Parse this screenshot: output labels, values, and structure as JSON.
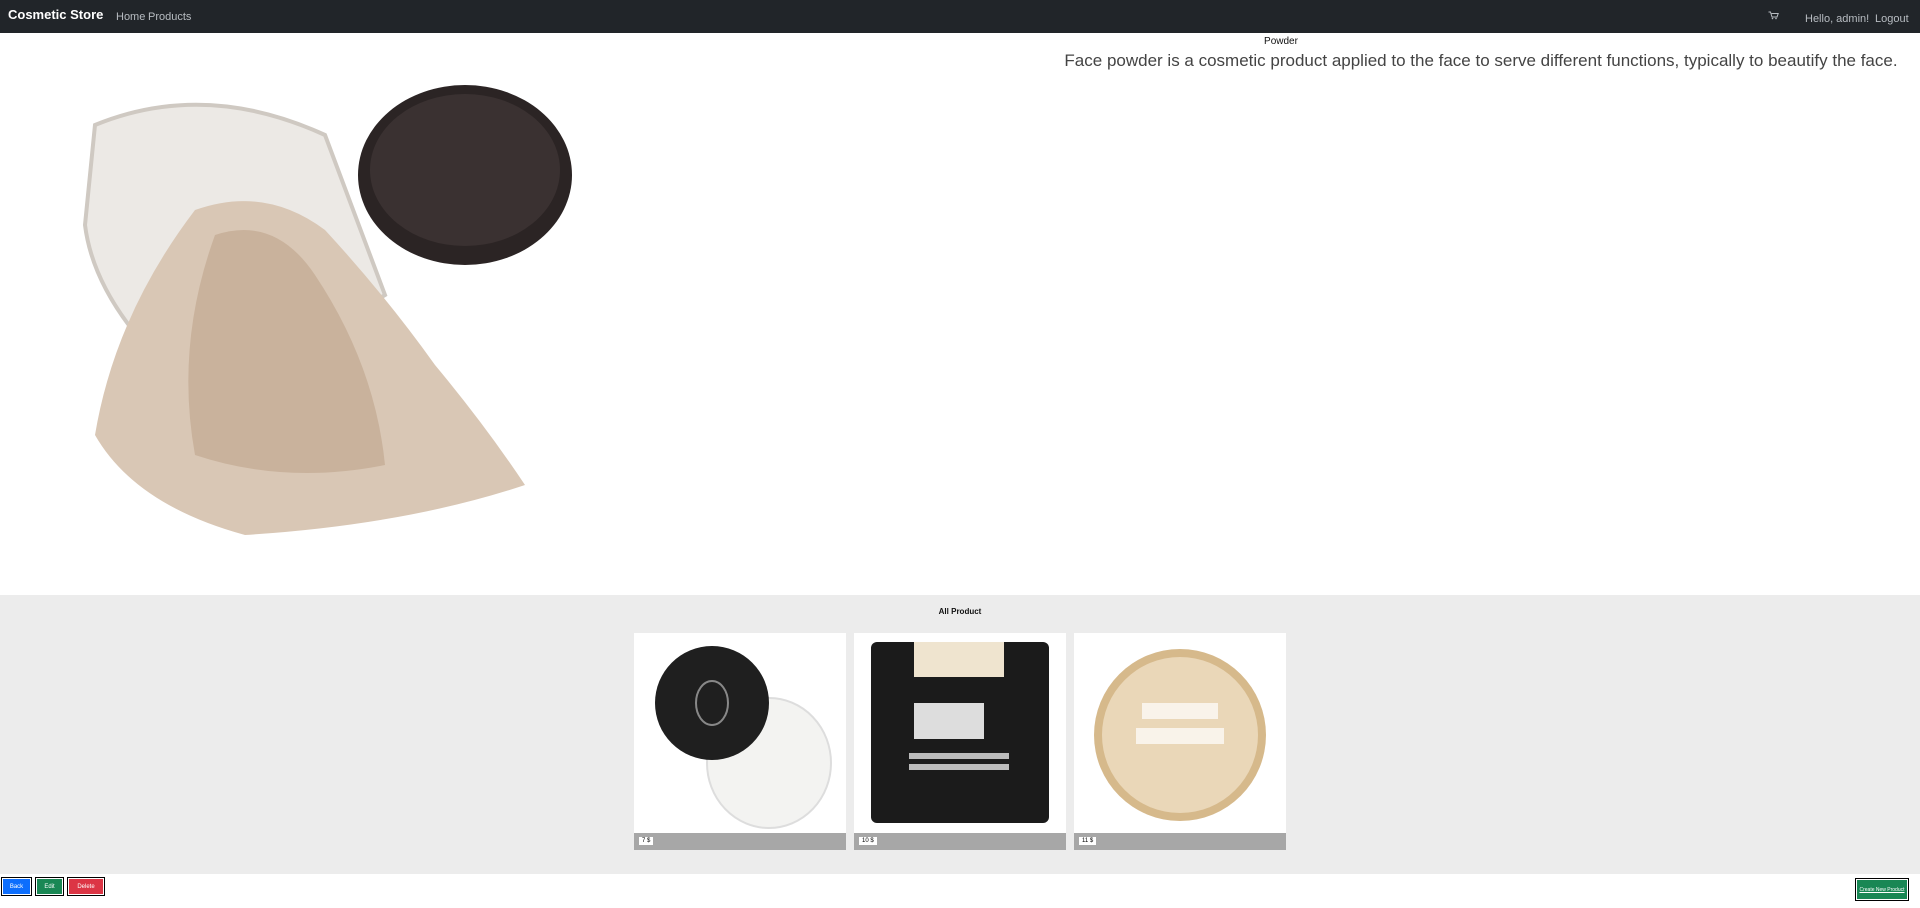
{
  "navbar": {
    "brand": "Cosmetic Store",
    "links": [
      "Home",
      "Products"
    ],
    "cart_icon": "cart-icon",
    "greeting": "Hello, admin!",
    "logout": "Logout"
  },
  "product": {
    "name": "Powder",
    "description": "Face powder is a cosmetic product applied to the face to serve different functions, typically to beautify the face."
  },
  "all_products": {
    "title": "All Product",
    "items": [
      {
        "price": "7 $"
      },
      {
        "price": "10 $"
      },
      {
        "price": "11 $"
      }
    ]
  },
  "actions": {
    "back": "Back",
    "edit": "Edit",
    "delete": "Delete",
    "create": "Create New Product"
  },
  "colors": {
    "navbar": "#212529",
    "back": "#0d6efd",
    "edit": "#198754",
    "delete": "#dc3545",
    "band": "#ececec"
  }
}
